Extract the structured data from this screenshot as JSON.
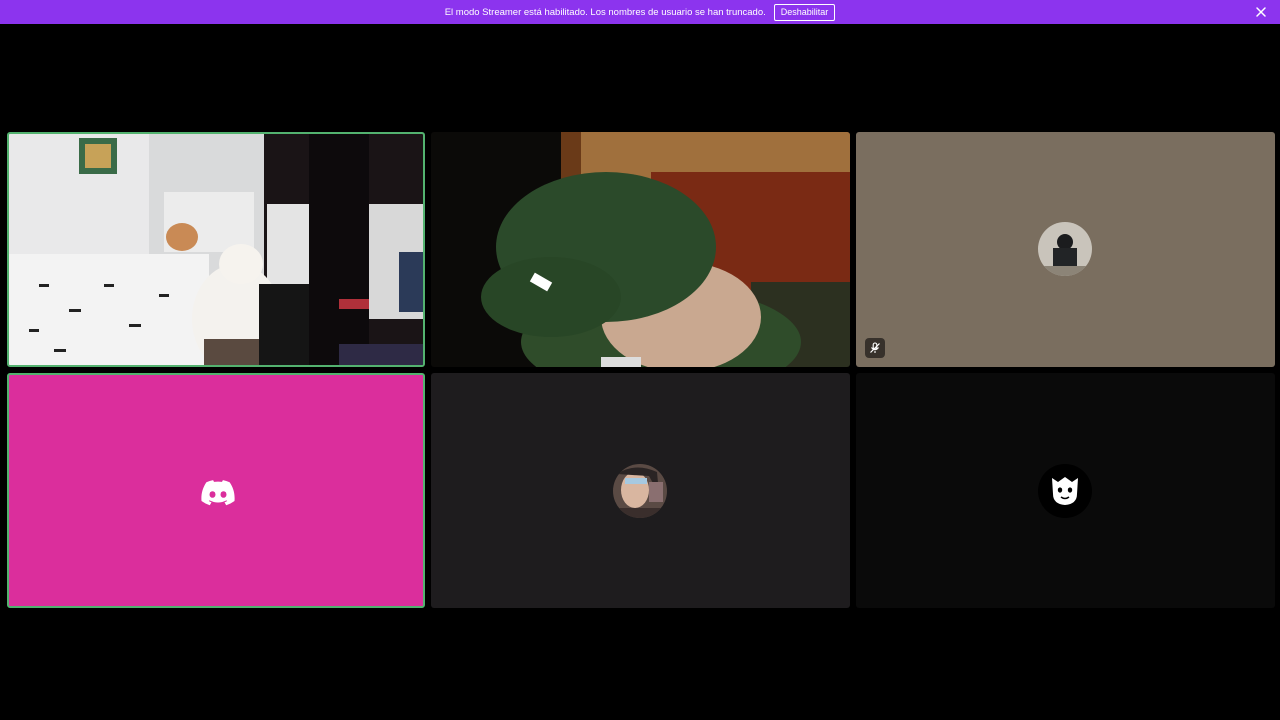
{
  "notice": {
    "message": "El modo Streamer está habilitado. Los nombres de usuario se han truncado.",
    "disable_label": "Deshabilitar",
    "background_color": "#8c34ee"
  },
  "tiles": [
    {
      "id": "tile-1",
      "type": "video",
      "speaking": true
    },
    {
      "id": "tile-2",
      "type": "video",
      "speaking": false
    },
    {
      "id": "tile-3",
      "type": "avatar",
      "muted": true,
      "background_color": "#7a6e5f"
    },
    {
      "id": "tile-4",
      "type": "discord-logo",
      "speaking": true,
      "background_color": "#db2e9c"
    },
    {
      "id": "tile-5",
      "type": "avatar",
      "background_color": "#1e1c1e"
    },
    {
      "id": "tile-6",
      "type": "avatar",
      "icon": "ghost-icon",
      "background_color": "#0a0a0a"
    }
  ],
  "colors": {
    "speaking_ring": "#53b26f"
  }
}
